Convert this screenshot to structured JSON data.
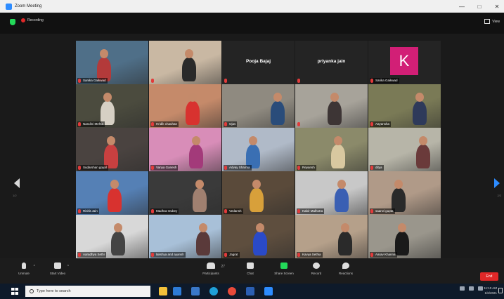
{
  "window": {
    "title": "Zoom Meeting",
    "controls": [
      "—",
      "□",
      "✕"
    ]
  },
  "meeting": {
    "recording_label": "Recording",
    "view_label": "View"
  },
  "gallery": {
    "tiles": [
      {
        "name": "Sanika Gaikwad",
        "kind": "video",
        "bg": "#4f6f88",
        "fg": "#b33a3a",
        "active": true
      },
      {
        "name": "",
        "kind": "video",
        "bg": "#c9b8a3",
        "fg": "#2a2a2a"
      },
      {
        "name": "Pooja Bajaj",
        "kind": "name_only"
      },
      {
        "name": "priyanka jain",
        "kind": "name_only"
      },
      {
        "name": "Sarika Gaikwad",
        "kind": "avatar",
        "letter": "K"
      },
      {
        "name": "Nandini Mehta",
        "kind": "video",
        "bg": "#4b4b3e",
        "fg": "#d6d0c4"
      },
      {
        "name": "Hridik chauhan",
        "kind": "video",
        "bg": "#c58a6a",
        "fg": "#d8322f"
      },
      {
        "name": "Ojas",
        "kind": "video",
        "bg": "#8f8a80",
        "fg": "#2a4c7a"
      },
      {
        "name": "",
        "kind": "video",
        "bg": "#a7a39a",
        "fg": "#3d3535"
      },
      {
        "name": "Aayansha",
        "kind": "video",
        "bg": "#7a7a56",
        "fg": "#2e3a5a"
      },
      {
        "name": "Sudarshan goyal",
        "kind": "video",
        "bg": "#4a4340",
        "fg": "#c84040"
      },
      {
        "name": "Vanya Ganesh",
        "kind": "video",
        "bg": "#d88db8",
        "fg": "#a33a7a"
      },
      {
        "name": "Advay Sharma",
        "kind": "video",
        "bg": "#b0bac8",
        "fg": "#3a6fb3"
      },
      {
        "name": "Reyansh",
        "kind": "video",
        "bg": "#8b8a6a",
        "fg": "#d8c8a0"
      },
      {
        "name": "ditya",
        "kind": "video",
        "bg": "#b7b5a8",
        "fg": "#6a3a3a"
      },
      {
        "name": "Rishit Jain",
        "kind": "video",
        "bg": "#5580b5",
        "fg": "#d8322f"
      },
      {
        "name": "Madhav Dubey",
        "kind": "video",
        "bg": "#3a3a3a",
        "fg": "#a08070"
      },
      {
        "name": "Vedansh",
        "kind": "video",
        "bg": "#5a4a3a",
        "fg": "#d8a03a"
      },
      {
        "name": "Kabir Malhotra",
        "kind": "video",
        "bg": "#c8c8c8",
        "fg": "#3a5fb3"
      },
      {
        "name": "saanvi gupta",
        "kind": "video",
        "bg": "#b09a88",
        "fg": "#2a2a2a"
      },
      {
        "name": "Aaradhya Sethi",
        "kind": "video",
        "bg": "#d8d8d8",
        "fg": "#444"
      },
      {
        "name": "lakshya and ayansh",
        "kind": "video",
        "bg": "#a8c0d8",
        "fg": "#5a3a3a"
      },
      {
        "name": "Jagrat",
        "kind": "video",
        "bg": "#5e4e3e",
        "fg": "#2a4ac8"
      },
      {
        "name": "Kavya Sethia",
        "kind": "video",
        "bg": "#b5a08a",
        "fg": "#2a2a2a"
      },
      {
        "name": "Aarav Khanna",
        "kind": "video",
        "bg": "#9a968c",
        "fg": "#1a1a1a"
      }
    ],
    "page_left": "1/2",
    "page_right": "2/2"
  },
  "controls": {
    "unmute": "Unmute",
    "start_video": "Start Video",
    "participants": "Participants",
    "participants_count": "27",
    "chat": "Chat",
    "share_screen": "Share Screen",
    "record": "Record",
    "reactions": "Reactions",
    "end": "End"
  },
  "taskbar": {
    "search_placeholder": "Type here to search",
    "time": "11:10 AM",
    "date": "1/6/2021",
    "apps": [
      {
        "name": "explorer",
        "color": "#f3c13a"
      },
      {
        "name": "mail",
        "color": "#2d7bd6"
      },
      {
        "name": "store",
        "color": "#3a78c8"
      },
      {
        "name": "edge",
        "color": "#1fa0d8"
      },
      {
        "name": "chrome",
        "color": "#e84a3a"
      },
      {
        "name": "word",
        "color": "#2b5fb3"
      },
      {
        "name": "zoom",
        "color": "#2d8cff"
      }
    ]
  },
  "colors": {
    "active_speaker": "#c8d62a",
    "end_button": "#e02828",
    "share_screen": "#23d959",
    "avatar_bg": "#d21f76"
  }
}
